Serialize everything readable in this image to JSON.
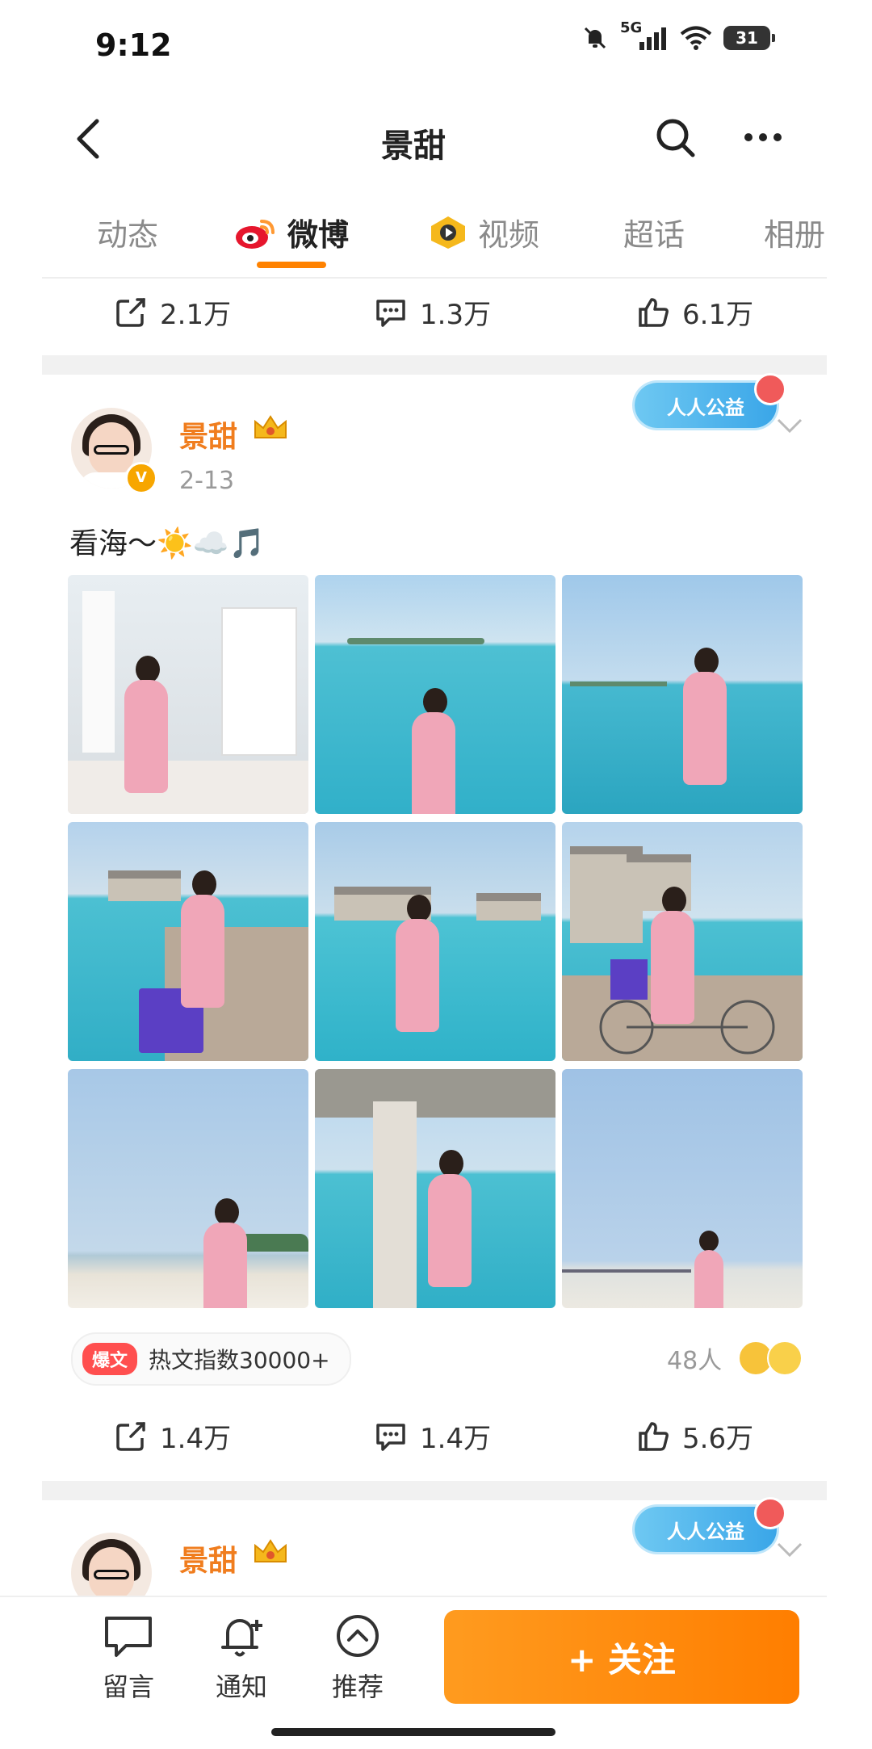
{
  "status_bar": {
    "time": "9:12",
    "network": "5G",
    "battery": "31"
  },
  "header": {
    "title": "景甜"
  },
  "tabs": [
    {
      "label": "动态"
    },
    {
      "label": "微博"
    },
    {
      "label": "视频"
    },
    {
      "label": "超话"
    },
    {
      "label": "相册"
    }
  ],
  "prev_post_actions": {
    "repost": "2.1万",
    "comment": "1.3万",
    "like": "6.1万"
  },
  "post": {
    "username": "景甜",
    "date": "2-13",
    "text": "看海～☀️☁️🎵",
    "badge": "人人公益",
    "hot_tag": "爆文",
    "hot_label": "热文指数30000+",
    "reactions": "48人",
    "actions": {
      "repost": "1.4万",
      "comment": "1.4万",
      "like": "5.6万"
    }
  },
  "next_post": {
    "username": "景甜",
    "badge": "人人公益"
  },
  "bottom_bar": {
    "message": "留言",
    "notify": "通知",
    "recommend": "推荐",
    "follow": "+ 关注"
  },
  "colors": {
    "accent": "#ff8200",
    "username": "#f07d1e",
    "follow_button": "#ff8a00"
  }
}
